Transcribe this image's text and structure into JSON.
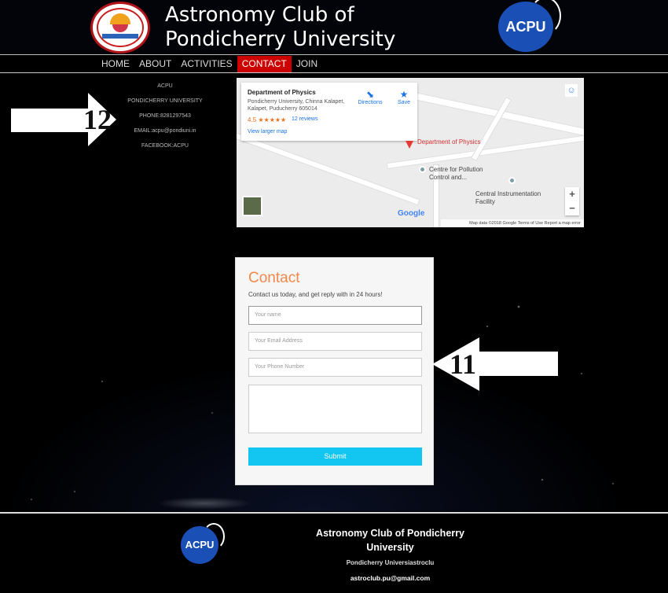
{
  "header": {
    "title_line1": "Astronomy Club of",
    "title_line2": "Pondicherry University",
    "acpu_logo_text": "ACPU"
  },
  "nav": {
    "items": [
      {
        "label": "HOME"
      },
      {
        "label": "ABOUT"
      },
      {
        "label": "ACTIVITIES"
      },
      {
        "label": "CONTACT",
        "active": true
      },
      {
        "label": "JOIN"
      }
    ]
  },
  "info": {
    "lines": [
      "ACPU",
      "PONDICHERRY UNIVERSITY",
      "PHONE:8281297543",
      "EMAIL:acpu@pondiuni.in",
      "FACEBOOK:ACPU"
    ]
  },
  "annotations": {
    "arrow_12": "12",
    "arrow_11": "11"
  },
  "map": {
    "place_title": "Department of Physics",
    "address": "Pondicherry University, Chinna Kalapet, Kalapet, Puducherry 605014",
    "rating": "4.5 ★★★★★",
    "reviews": "12 reviews",
    "view_larger": "View larger map",
    "directions": "Directions",
    "save": "Save",
    "pin_main": "Department of Physics",
    "pin_pollution": "Centre for Pollution Control and...",
    "pin_instrumentation": "Central Instrumentation Facility",
    "zoom_in": "+",
    "zoom_out": "−",
    "google": "Google",
    "footer": "Map data ©2018 Google    Terms of Use    Report a map error"
  },
  "form": {
    "title": "Contact",
    "subtitle": "Contact us today, and get reply with in 24 hours!",
    "name_placeholder": "Your name",
    "email_placeholder": "Your Email Address",
    "phone_placeholder": "Your Phone Number",
    "submit_label": "Submit"
  },
  "footer": {
    "logo_text": "ACPU",
    "title": "Astronomy Club of Pondicherry University",
    "subtitle": "Pondicherry Universiastroclu",
    "email": "astroclub.pu@gmail.com"
  }
}
